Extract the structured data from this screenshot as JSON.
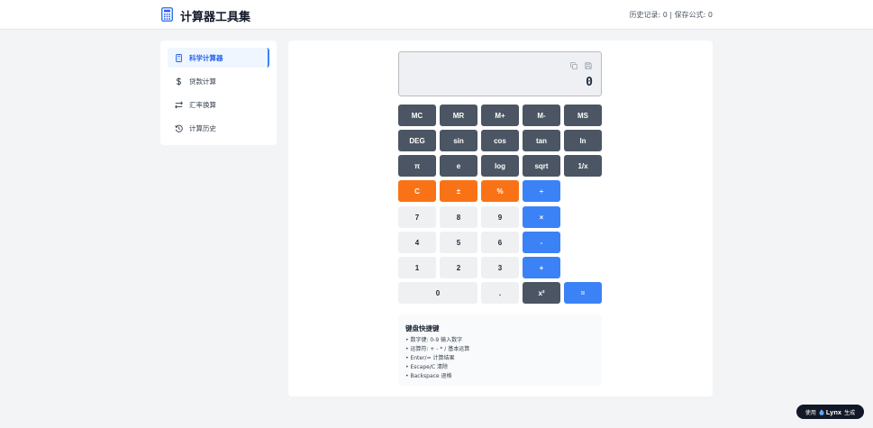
{
  "header": {
    "title": "计算器工具集",
    "stats": "历史记录: 0 | 保存公式: 0",
    "logo_icon": "calculator-icon"
  },
  "sidebar": {
    "items": [
      {
        "label": "科学计算器",
        "icon": "calculator-icon",
        "active": true
      },
      {
        "label": "贷款计算",
        "icon": "dollar-icon",
        "active": false
      },
      {
        "label": "汇率换算",
        "icon": "exchange-icon",
        "active": false
      },
      {
        "label": "计算历史",
        "icon": "history-icon",
        "active": false
      }
    ]
  },
  "display": {
    "value": "0",
    "copy_icon": "copy-icon",
    "save_icon": "save-icon"
  },
  "keys": {
    "mc": "MC",
    "mr": "MR",
    "mplus": "M+",
    "mminus": "M-",
    "ms": "MS",
    "deg": "DEG",
    "sin": "sin",
    "cos": "cos",
    "tan": "tan",
    "ln": "ln",
    "pi": "π",
    "e": "e",
    "log": "log",
    "sqrt": "sqrt",
    "recip": "1/x",
    "clear": "C",
    "sign": "±",
    "percent": "%",
    "divide": "÷",
    "seven": "7",
    "eight": "8",
    "nine": "9",
    "multiply": "×",
    "four": "4",
    "five": "5",
    "six": "6",
    "minus": "-",
    "one": "1",
    "two": "2",
    "three": "3",
    "plus": "+",
    "zero": "0",
    "dot": ".",
    "square": "x²",
    "equals": "="
  },
  "shortcuts": {
    "title": "键盘快捷键",
    "lines": [
      "• 数字键: 0-9 输入数字",
      "• 运算符: + - * / 基本运算",
      "• Enter/= 计算结果",
      "• Escape/C 清除",
      "• Backspace 退格"
    ]
  },
  "badge": {
    "prefix": "使用",
    "brand": "Lynx",
    "suffix": "生成"
  },
  "colors": {
    "accent": "#3b82f6",
    "function_key": "#4b5563",
    "clear_key": "#f97316",
    "digit_key": "#eef0f2"
  }
}
